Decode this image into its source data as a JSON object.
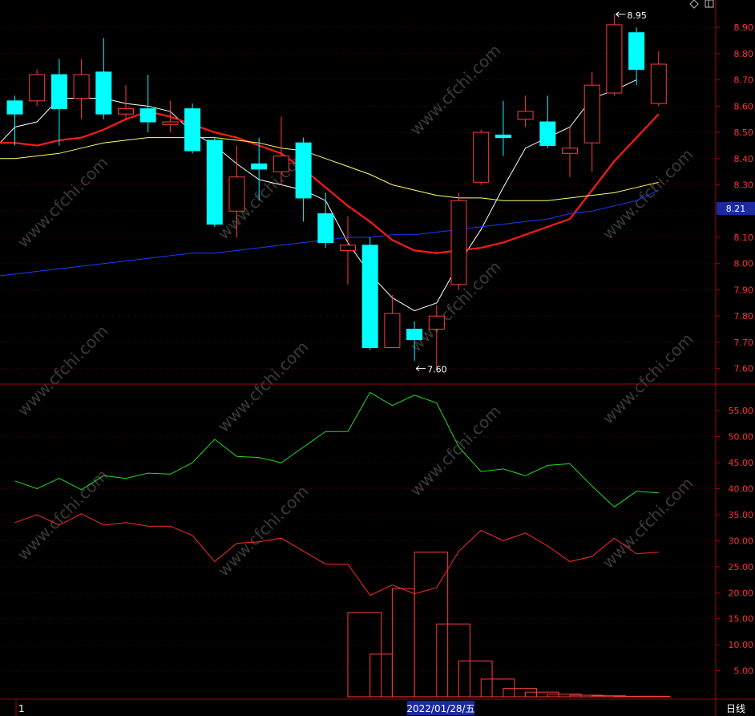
{
  "app": {
    "period_label": "日线",
    "date_label": "2022/01/28/五",
    "index_label": "1",
    "current_price": "8.21",
    "watermark": "www.cfchi.com"
  },
  "colors": {
    "background": "#000000",
    "up": "#ff3c3c",
    "down": "#00ffff",
    "ma_fast": "#ffffff",
    "ma_mid": "#ff1a1a",
    "ma_slow": "#ffff66",
    "ma_long": "#1a3cff",
    "ind_green": "#22dd22",
    "ind_red": "#ff2a2a",
    "axis": "#aa0000",
    "price_badge": "#1a2aa0"
  },
  "icons": {
    "top_right": [
      "diamond-icon",
      "window-icon"
    ]
  },
  "chart_data": [
    {
      "type": "candlestick",
      "price_ticks": [
        "8.90",
        "8.80",
        "8.70",
        "8.60",
        "8.50",
        "8.40",
        "8.30",
        "8.20",
        "8.10",
        "8.00",
        "7.90",
        "7.80",
        "7.70",
        "7.60"
      ],
      "ylim": [
        7.55,
        8.98
      ],
      "annotations": [
        {
          "text": "8.95",
          "index": 27,
          "value": 8.95
        },
        {
          "text": "7.60",
          "index": 18,
          "value": 7.6
        }
      ],
      "candles": [
        {
          "o": 8.62,
          "c": 8.57,
          "h": 8.64,
          "l": 8.45
        },
        {
          "o": 8.62,
          "c": 8.72,
          "h": 8.74,
          "l": 8.6
        },
        {
          "o": 8.72,
          "c": 8.59,
          "h": 8.78,
          "l": 8.45
        },
        {
          "o": 8.63,
          "c": 8.72,
          "h": 8.78,
          "l": 8.55
        },
        {
          "o": 8.73,
          "c": 8.57,
          "h": 8.86,
          "l": 8.55
        },
        {
          "o": 8.57,
          "c": 8.59,
          "h": 8.68,
          "l": 8.55
        },
        {
          "o": 8.59,
          "c": 8.54,
          "h": 8.72,
          "l": 8.5
        },
        {
          "o": 8.53,
          "c": 8.54,
          "h": 8.62,
          "l": 8.5
        },
        {
          "o": 8.59,
          "c": 8.43,
          "h": 8.61,
          "l": 8.42
        },
        {
          "o": 8.47,
          "c": 8.15,
          "h": 8.48,
          "l": 8.14
        },
        {
          "o": 8.2,
          "c": 8.33,
          "h": 8.45,
          "l": 8.1
        },
        {
          "o": 8.38,
          "c": 8.36,
          "h": 8.48,
          "l": 8.24
        },
        {
          "o": 8.35,
          "c": 8.41,
          "h": 8.56,
          "l": 8.3
        },
        {
          "o": 8.46,
          "c": 8.25,
          "h": 8.48,
          "l": 8.16
        },
        {
          "o": 8.19,
          "c": 8.08,
          "h": 8.27,
          "l": 8.06
        },
        {
          "o": 8.05,
          "c": 8.07,
          "h": 8.18,
          "l": 7.92
        },
        {
          "o": 8.07,
          "c": 7.68,
          "h": 8.1,
          "l": 7.67
        },
        {
          "o": 7.68,
          "c": 7.81,
          "h": 7.88,
          "l": 7.68
        },
        {
          "o": 7.75,
          "c": 7.71,
          "h": 7.78,
          "l": 7.63
        },
        {
          "o": 7.75,
          "c": 7.8,
          "h": 7.84,
          "l": 7.6
        },
        {
          "o": 7.92,
          "c": 8.24,
          "h": 8.27,
          "l": 7.9
        },
        {
          "o": 8.31,
          "c": 8.5,
          "h": 8.51,
          "l": 8.3
        },
        {
          "o": 8.49,
          "c": 8.48,
          "h": 8.62,
          "l": 8.41
        },
        {
          "o": 8.55,
          "c": 8.58,
          "h": 8.64,
          "l": 8.52
        },
        {
          "o": 8.54,
          "c": 8.45,
          "h": 8.64,
          "l": 8.44
        },
        {
          "o": 8.42,
          "c": 8.44,
          "h": 8.52,
          "l": 8.33
        },
        {
          "o": 8.46,
          "c": 8.68,
          "h": 8.73,
          "l": 8.35
        },
        {
          "o": 8.65,
          "c": 8.91,
          "h": 8.95,
          "l": 8.64
        },
        {
          "o": 8.88,
          "c": 8.74,
          "h": 8.9,
          "l": 8.68
        },
        {
          "o": 8.61,
          "c": 8.76,
          "h": 8.81,
          "l": 8.6
        }
      ],
      "ma_lines": [
        {
          "key": "ma_fast",
          "values": [
            8.43,
            8.52,
            8.54,
            8.63,
            8.63,
            8.63,
            8.61,
            8.6,
            8.58,
            8.5,
            8.45,
            8.38,
            8.32,
            8.3,
            8.28,
            8.24,
            8.08,
            7.96,
            7.87,
            7.82,
            7.85,
            8.0,
            8.13,
            8.29,
            8.44,
            8.48,
            8.52,
            8.63,
            8.66,
            8.7
          ]
        },
        {
          "key": "ma_mid",
          "values": [
            8.46,
            8.46,
            8.45,
            8.47,
            8.48,
            8.51,
            8.55,
            8.58,
            8.56,
            8.53,
            8.5,
            8.48,
            8.45,
            8.42,
            8.36,
            8.29,
            8.22,
            8.16,
            8.09,
            8.05,
            8.04,
            8.05,
            8.06,
            8.08,
            8.11,
            8.14,
            8.17,
            8.28,
            8.39,
            8.48,
            8.57
          ]
        },
        {
          "key": "ma_slow",
          "values": [
            8.4,
            8.4,
            8.41,
            8.42,
            8.44,
            8.46,
            8.47,
            8.48,
            8.48,
            8.48,
            8.48,
            8.47,
            8.46,
            8.44,
            8.43,
            8.4,
            8.37,
            8.34,
            8.3,
            8.28,
            8.26,
            8.25,
            8.25,
            8.24,
            8.24,
            8.24,
            8.25,
            8.26,
            8.27,
            8.29,
            8.31
          ]
        },
        {
          "key": "ma_long",
          "values": [
            7.95,
            7.96,
            7.97,
            7.98,
            7.99,
            8.0,
            8.01,
            8.02,
            8.03,
            8.04,
            8.04,
            8.05,
            8.06,
            8.07,
            8.08,
            8.09,
            8.1,
            8.1,
            8.11,
            8.11,
            8.12,
            8.13,
            8.14,
            8.15,
            8.16,
            8.17,
            8.19,
            8.2,
            8.22,
            8.24,
            8.28
          ]
        }
      ]
    },
    {
      "type": "line",
      "ticks": [
        "55.00",
        "50.00",
        "45.00",
        "40.00",
        "35.00",
        "30.00",
        "25.00",
        "20.00",
        "15.00",
        "10.00",
        "5.00"
      ],
      "ylim": [
        0,
        59.2
      ],
      "series": [
        {
          "key": "ind_green",
          "values": [
            41.5,
            40.0,
            42.0,
            39.8,
            42.5,
            42.0,
            43.0,
            42.8,
            45.0,
            49.5,
            46.2,
            46.0,
            45.0,
            48.0,
            51.0,
            51.0,
            58.5,
            56.0,
            58.0,
            56.5,
            48.0,
            43.3,
            43.8,
            42.5,
            44.5,
            44.8,
            40.5,
            36.5,
            39.5,
            39.2
          ]
        },
        {
          "key": "ind_red",
          "values": [
            33.5,
            35.0,
            33.0,
            35.2,
            33.0,
            33.5,
            32.8,
            32.8,
            31.0,
            26.0,
            29.5,
            29.8,
            30.5,
            28.0,
            25.5,
            25.5,
            19.5,
            21.5,
            19.8,
            21.0,
            28.0,
            32.0,
            30.0,
            31.5,
            29.0,
            26.0,
            27.0,
            30.5,
            27.5,
            27.8
          ]
        }
      ],
      "histogram": [
        {
          "from": 15,
          "to": 16.5,
          "value": 16.2
        },
        {
          "from": 16,
          "to": 17,
          "value": 8.2
        },
        {
          "from": 17,
          "to": 18,
          "value": 20.8
        },
        {
          "from": 18,
          "to": 19.5,
          "value": 27.8
        },
        {
          "from": 19,
          "to": 20.5,
          "value": 14.0
        },
        {
          "from": 20,
          "to": 21.5,
          "value": 6.9
        },
        {
          "from": 21,
          "to": 22.5,
          "value": 3.4
        },
        {
          "from": 22,
          "to": 23.5,
          "value": 1.6
        },
        {
          "from": 23,
          "to": 24.5,
          "value": 0.9
        },
        {
          "from": 24,
          "to": 25.5,
          "value": 0.5
        },
        {
          "from": 25,
          "to": 26.5,
          "value": 0.3
        },
        {
          "from": 26,
          "to": 27.5,
          "value": 0.2
        },
        {
          "from": 27,
          "to": 29.5,
          "value": 0.1
        }
      ]
    }
  ]
}
